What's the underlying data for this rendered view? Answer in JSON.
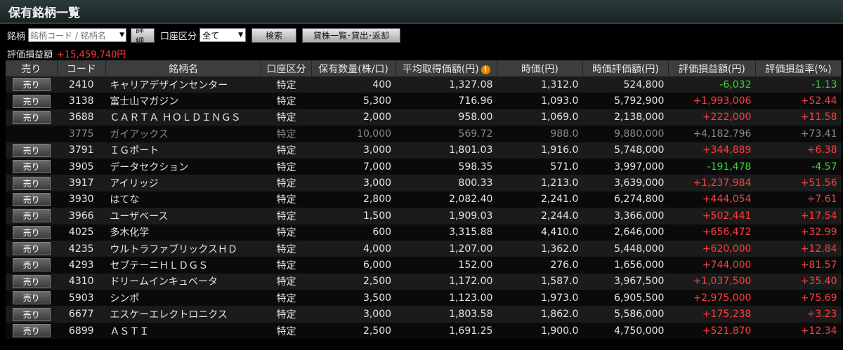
{
  "header": {
    "title": "保有銘柄一覧"
  },
  "controls": {
    "stock_label": "銘柄",
    "search_placeholder": "銘柄コード / 銘柄名",
    "detail_label": "詳細",
    "account_label": "口座区分",
    "account_value": "全て",
    "search_button": "検索",
    "lending_button": "貸株一覧･貸出･返却"
  },
  "summary": {
    "label": "評価損益額",
    "value": "+15,459,740円"
  },
  "table": {
    "headers": [
      "売り",
      "コード",
      "銘柄名",
      "口座区分",
      "保有数量(株/口)",
      "平均取得価額(円)",
      "時価(円)",
      "時価評価額(円)",
      "評価損益額(円)",
      "評価損益率(%)"
    ],
    "sell_label": "売り",
    "rows": [
      {
        "code": "2410",
        "name": "キャリアデザインセンター",
        "account": "特定",
        "qty": "400",
        "avg": "1,327.08",
        "price": "1,312.0",
        "value": "524,800",
        "pl": "-6,032",
        "rate": "-1.13",
        "sign": "neg",
        "sellable": true
      },
      {
        "code": "3138",
        "name": "富士山マガジン",
        "account": "特定",
        "qty": "5,300",
        "avg": "716.96",
        "price": "1,093.0",
        "value": "5,792,900",
        "pl": "+1,993,006",
        "rate": "+52.44",
        "sign": "pos",
        "sellable": true
      },
      {
        "code": "3688",
        "name": "ＣＡＲＴＡ ＨＯＬＤＩＮＧＳ",
        "account": "特定",
        "qty": "2,000",
        "avg": "958.00",
        "price": "1,069.0",
        "value": "2,138,000",
        "pl": "+222,000",
        "rate": "+11.58",
        "sign": "pos",
        "sellable": true
      },
      {
        "code": "3775",
        "name": "ガイアックス",
        "account": "特定",
        "qty": "10,000",
        "avg": "569.72",
        "price": "988.0",
        "value": "9,880,000",
        "pl": "+4,182,796",
        "rate": "+73.41",
        "sign": "muted",
        "sellable": false
      },
      {
        "code": "3791",
        "name": "ＩＧポート",
        "account": "特定",
        "qty": "3,000",
        "avg": "1,801.03",
        "price": "1,916.0",
        "value": "5,748,000",
        "pl": "+344,889",
        "rate": "+6.38",
        "sign": "pos",
        "sellable": true
      },
      {
        "code": "3905",
        "name": "データセクション",
        "account": "特定",
        "qty": "7,000",
        "avg": "598.35",
        "price": "571.0",
        "value": "3,997,000",
        "pl": "-191,478",
        "rate": "-4.57",
        "sign": "neg",
        "sellable": true
      },
      {
        "code": "3917",
        "name": "アイリッジ",
        "account": "特定",
        "qty": "3,000",
        "avg": "800.33",
        "price": "1,213.0",
        "value": "3,639,000",
        "pl": "+1,237,984",
        "rate": "+51.56",
        "sign": "pos",
        "sellable": true
      },
      {
        "code": "3930",
        "name": "はてな",
        "account": "特定",
        "qty": "2,800",
        "avg": "2,082.40",
        "price": "2,241.0",
        "value": "6,274,800",
        "pl": "+444,054",
        "rate": "+7.61",
        "sign": "pos",
        "sellable": true
      },
      {
        "code": "3966",
        "name": "ユーザベース",
        "account": "特定",
        "qty": "1,500",
        "avg": "1,909.03",
        "price": "2,244.0",
        "value": "3,366,000",
        "pl": "+502,441",
        "rate": "+17.54",
        "sign": "pos",
        "sellable": true
      },
      {
        "code": "4025",
        "name": "多木化学",
        "account": "特定",
        "qty": "600",
        "avg": "3,315.88",
        "price": "4,410.0",
        "value": "2,646,000",
        "pl": "+656,472",
        "rate": "+32.99",
        "sign": "pos",
        "sellable": true
      },
      {
        "code": "4235",
        "name": "ウルトラファブリックスＨＤ",
        "account": "特定",
        "qty": "4,000",
        "avg": "1,207.00",
        "price": "1,362.0",
        "value": "5,448,000",
        "pl": "+620,000",
        "rate": "+12.84",
        "sign": "pos",
        "sellable": true
      },
      {
        "code": "4293",
        "name": "セプテーニＨＬＤＧＳ",
        "account": "特定",
        "qty": "6,000",
        "avg": "152.00",
        "price": "276.0",
        "value": "1,656,000",
        "pl": "+744,000",
        "rate": "+81.57",
        "sign": "pos",
        "sellable": true
      },
      {
        "code": "4310",
        "name": "ドリームインキュベータ",
        "account": "特定",
        "qty": "2,500",
        "avg": "1,172.00",
        "price": "1,587.0",
        "value": "3,967,500",
        "pl": "+1,037,500",
        "rate": "+35.40",
        "sign": "pos",
        "sellable": true
      },
      {
        "code": "5903",
        "name": "シンポ",
        "account": "特定",
        "qty": "3,500",
        "avg": "1,123.00",
        "price": "1,973.0",
        "value": "6,905,500",
        "pl": "+2,975,000",
        "rate": "+75.69",
        "sign": "pos",
        "sellable": true
      },
      {
        "code": "6677",
        "name": "エスケーエレクトロニクス",
        "account": "特定",
        "qty": "3,000",
        "avg": "1,803.58",
        "price": "1,862.0",
        "value": "5,586,000",
        "pl": "+175,238",
        "rate": "+3.23",
        "sign": "pos",
        "sellable": true
      },
      {
        "code": "6899",
        "name": "ＡＳＴＩ",
        "account": "特定",
        "qty": "2,500",
        "avg": "1,691.25",
        "price": "1,900.0",
        "value": "4,750,000",
        "pl": "+521,870",
        "rate": "+12.34",
        "sign": "pos",
        "sellable": true
      }
    ]
  },
  "colors": {
    "positive": "#ff3d3d",
    "negative": "#39d839",
    "muted": "#8a8a8a"
  }
}
